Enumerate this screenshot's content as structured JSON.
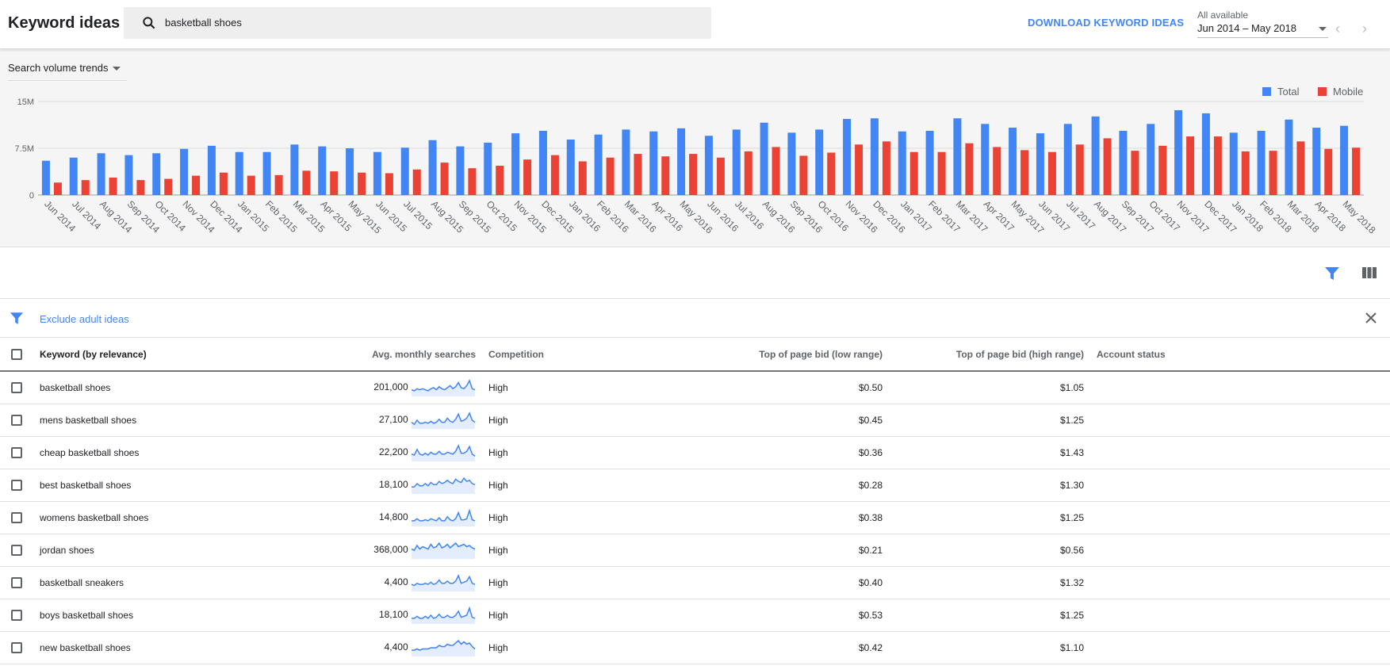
{
  "header": {
    "title": "Keyword ideas",
    "search_value": "basketball shoes",
    "download_label": "DOWNLOAD KEYWORD IDEAS",
    "date_label": "All available",
    "date_range": "Jun 2014 – May 2018",
    "prev_icon": "chevron-left-icon",
    "next_icon": "chevron-right-icon"
  },
  "chart_panel": {
    "selector_label": "Search volume trends"
  },
  "colors": {
    "total": "#4285f4",
    "mobile": "#ea4335",
    "accent": "#4285f4"
  },
  "chart_data": {
    "type": "bar",
    "title": "Search volume trends",
    "xlabel": "",
    "ylabel": "",
    "ylim": [
      0,
      15000000
    ],
    "yticks": [
      "0",
      "7.5M",
      "15M"
    ],
    "ytick_values": [
      0,
      7500000,
      15000000
    ],
    "grid": true,
    "legend_position": "top-right",
    "categories": [
      "Jun 2014",
      "Jul 2014",
      "Aug 2014",
      "Sep 2014",
      "Oct 2014",
      "Nov 2014",
      "Dec 2014",
      "Jan 2015",
      "Feb 2015",
      "Mar 2015",
      "Apr 2015",
      "May 2015",
      "Jun 2015",
      "Jul 2015",
      "Aug 2015",
      "Sep 2015",
      "Oct 2015",
      "Nov 2015",
      "Dec 2015",
      "Jan 2016",
      "Feb 2016",
      "Mar 2016",
      "Apr 2016",
      "May 2016",
      "Jun 2016",
      "Jul 2016",
      "Aug 2016",
      "Sep 2016",
      "Oct 2016",
      "Nov 2016",
      "Dec 2016",
      "Jan 2017",
      "Feb 2017",
      "Mar 2017",
      "Apr 2017",
      "May 2017",
      "Jun 2017",
      "Jul 2017",
      "Aug 2017",
      "Sep 2017",
      "Oct 2017",
      "Nov 2017",
      "Dec 2017",
      "Jan 2018",
      "Feb 2018",
      "Mar 2018",
      "Apr 2018",
      "May 2018"
    ],
    "series": [
      {
        "name": "Total",
        "values": [
          5500000,
          6000000,
          6700000,
          6400000,
          6700000,
          7400000,
          7900000,
          6900000,
          6900000,
          8100000,
          7800000,
          7500000,
          6900000,
          7600000,
          8800000,
          7800000,
          8400000,
          9900000,
          10300000,
          8900000,
          9700000,
          10500000,
          10200000,
          10700000,
          9500000,
          10500000,
          11600000,
          10000000,
          10500000,
          12200000,
          12300000,
          10200000,
          10300000,
          12300000,
          11400000,
          10800000,
          9900000,
          11400000,
          12600000,
          10300000,
          11400000,
          13600000,
          13100000,
          10000000,
          10300000,
          12100000,
          10800000,
          11100000
        ]
      },
      {
        "name": "Mobile",
        "values": [
          2000000,
          2400000,
          2800000,
          2400000,
          2600000,
          3100000,
          3600000,
          3100000,
          3200000,
          3900000,
          3800000,
          3600000,
          3500000,
          4100000,
          5200000,
          4300000,
          4700000,
          5700000,
          6400000,
          5400000,
          6000000,
          6600000,
          6200000,
          6600000,
          6000000,
          7000000,
          7700000,
          6300000,
          6800000,
          8100000,
          8600000,
          6900000,
          6900000,
          8300000,
          7700000,
          7200000,
          6900000,
          8100000,
          9100000,
          7100000,
          7900000,
          9400000,
          9400000,
          7000000,
          7100000,
          8600000,
          7400000,
          7600000
        ]
      }
    ]
  },
  "table_toolbar": {
    "filter_icon": "filter-icon",
    "columns_icon": "columns-icon"
  },
  "filter_bar": {
    "label": "Exclude adult ideas"
  },
  "table": {
    "headers": [
      "Keyword (by relevance)",
      "Avg. monthly searches",
      "Competition",
      "Top of page bid (low range)",
      "Top of page bid (high range)",
      "Account status"
    ],
    "rows": [
      {
        "keyword": "basketball shoes",
        "searches": "201,000",
        "competition": "High",
        "low": "$0.50",
        "high": "$1.05",
        "spark": [
          5,
          4,
          6,
          5,
          6,
          5,
          4,
          6,
          7,
          5,
          8,
          6,
          5,
          7,
          9,
          6,
          8,
          12,
          7,
          6,
          9,
          14,
          6,
          5
        ]
      },
      {
        "keyword": "mens basketball shoes",
        "searches": "27,100",
        "competition": "High",
        "low": "$0.45",
        "high": "$1.25",
        "spark": [
          5,
          3,
          7,
          4,
          4,
          5,
          4,
          6,
          4,
          5,
          8,
          5,
          5,
          9,
          6,
          5,
          8,
          13,
          6,
          7,
          9,
          14,
          7,
          5
        ]
      },
      {
        "keyword": "cheap basketball shoes",
        "searches": "22,200",
        "competition": "High",
        "low": "$0.36",
        "high": "$1.43",
        "spark": [
          6,
          5,
          11,
          6,
          5,
          7,
          5,
          8,
          6,
          6,
          9,
          6,
          6,
          8,
          7,
          6,
          9,
          15,
          7,
          7,
          9,
          14,
          6,
          4
        ]
      },
      {
        "keyword": "best basketball shoes",
        "searches": "18,100",
        "competition": "High",
        "low": "$0.28",
        "high": "$1.30",
        "spark": [
          5,
          5,
          8,
          6,
          6,
          8,
          6,
          9,
          7,
          7,
          10,
          8,
          9,
          11,
          9,
          8,
          12,
          10,
          9,
          13,
          10,
          11,
          8,
          7
        ]
      },
      {
        "keyword": "womens basketball shoes",
        "searches": "14,800",
        "competition": "High",
        "low": "$0.38",
        "high": "$1.25",
        "spark": [
          4,
          4,
          6,
          4,
          4,
          5,
          4,
          6,
          5,
          4,
          7,
          4,
          4,
          8,
          5,
          4,
          6,
          12,
          5,
          5,
          6,
          14,
          5,
          4
        ]
      },
      {
        "keyword": "jordan shoes",
        "searches": "368,000",
        "competition": "High",
        "low": "$0.21",
        "high": "$0.56",
        "spark": [
          7,
          6,
          10,
          7,
          9,
          8,
          7,
          11,
          8,
          9,
          12,
          8,
          9,
          11,
          8,
          10,
          12,
          9,
          10,
          11,
          9,
          10,
          8,
          7
        ]
      },
      {
        "keyword": "basketball sneakers",
        "searches": "4,400",
        "competition": "High",
        "low": "$0.40",
        "high": "$1.32",
        "spark": [
          5,
          4,
          6,
          5,
          5,
          6,
          5,
          7,
          5,
          6,
          9,
          6,
          6,
          8,
          6,
          6,
          8,
          13,
          6,
          7,
          8,
          12,
          6,
          5
        ]
      },
      {
        "keyword": "boys basketball shoes",
        "searches": "18,100",
        "competition": "High",
        "low": "$0.53",
        "high": "$1.25",
        "spark": [
          4,
          4,
          6,
          4,
          4,
          6,
          4,
          7,
          4,
          5,
          8,
          5,
          5,
          7,
          5,
          5,
          7,
          11,
          5,
          6,
          7,
          14,
          5,
          4
        ]
      },
      {
        "keyword": "new basketball shoes",
        "searches": "4,400",
        "competition": "High",
        "low": "$0.42",
        "high": "$1.10",
        "spark": [
          4,
          4,
          5,
          4,
          5,
          5,
          5,
          6,
          6,
          6,
          8,
          7,
          7,
          9,
          8,
          8,
          10,
          12,
          9,
          11,
          9,
          10,
          7,
          5
        ]
      }
    ]
  }
}
